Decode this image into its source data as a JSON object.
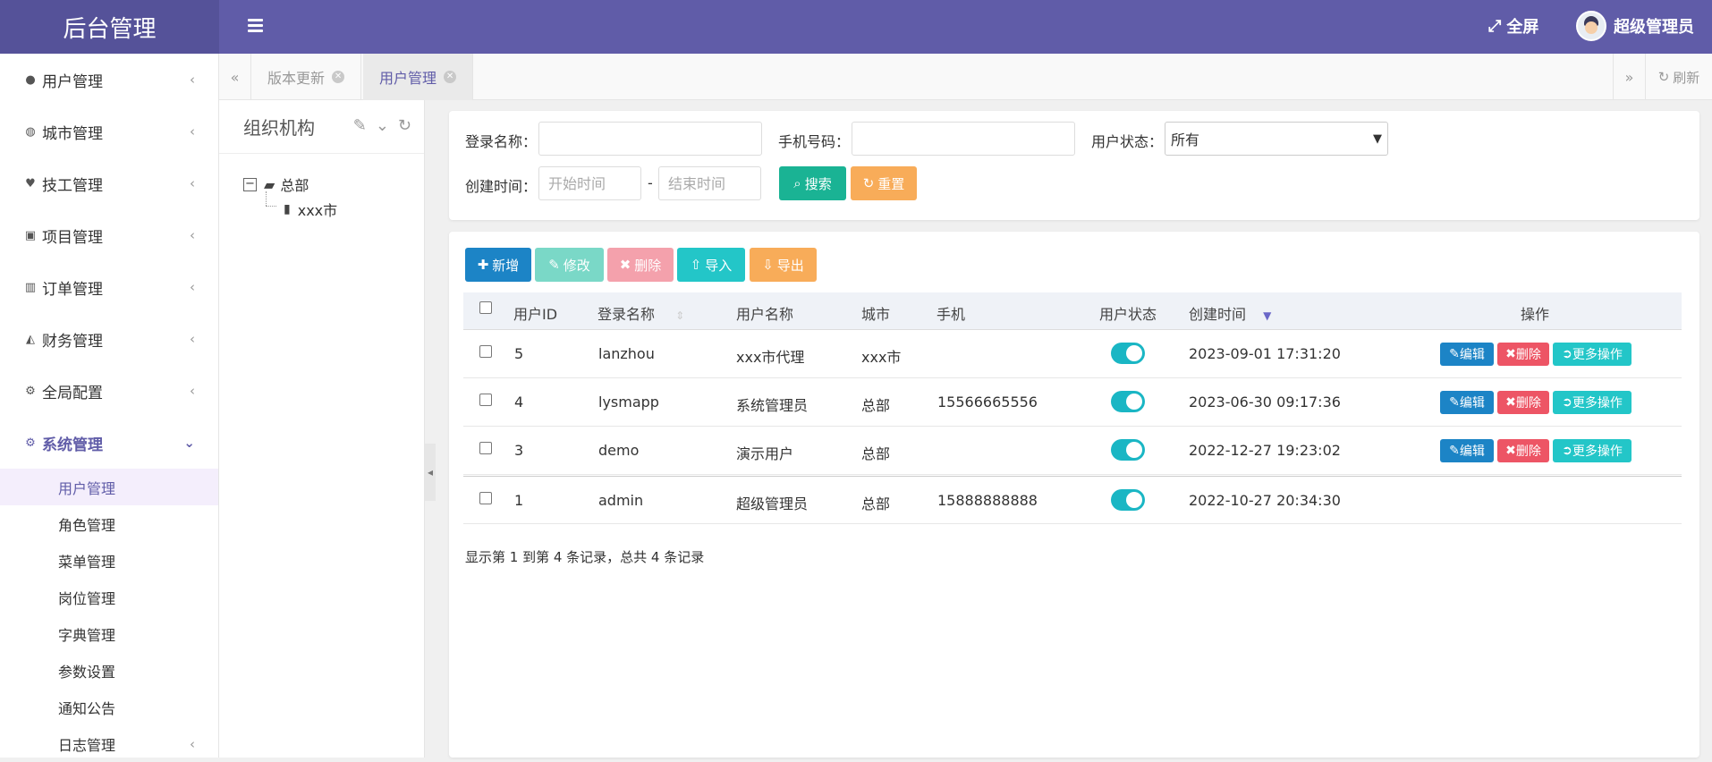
{
  "app": {
    "title": "后台管理"
  },
  "header": {
    "fullscreen_label": "全屏",
    "user_name": "超级管理员"
  },
  "sidebar": {
    "items": [
      {
        "label": "用户管理",
        "icon": "user-icon"
      },
      {
        "label": "城市管理",
        "icon": "globe-icon"
      },
      {
        "label": "技工管理",
        "icon": "heart-icon"
      },
      {
        "label": "项目管理",
        "icon": "ticket-icon"
      },
      {
        "label": "订单管理",
        "icon": "bar-chart-icon"
      },
      {
        "label": "财务管理",
        "icon": "area-chart-icon"
      },
      {
        "label": "全局配置",
        "icon": "cogs-icon"
      },
      {
        "label": "系统管理",
        "icon": "gear-icon"
      }
    ],
    "sub_items": [
      {
        "label": "用户管理"
      },
      {
        "label": "角色管理"
      },
      {
        "label": "菜单管理"
      },
      {
        "label": "岗位管理"
      },
      {
        "label": "字典管理"
      },
      {
        "label": "参数设置"
      },
      {
        "label": "通知公告"
      },
      {
        "label": "日志管理"
      }
    ]
  },
  "tabs": [
    {
      "label": "版本更新"
    },
    {
      "label": "用户管理"
    }
  ],
  "tab_refresh_label": "刷新",
  "tree": {
    "title": "组织机构",
    "root": "总部",
    "child": "xxx市"
  },
  "search": {
    "login_name_label": "登录名称：",
    "phone_label": "手机号码：",
    "status_label": "用户状态：",
    "status_value": "所有",
    "created_label": "创建时间：",
    "start_placeholder": "开始时间",
    "end_placeholder": "结束时间",
    "range_sep": "-",
    "search_btn": "搜索",
    "reset_btn": "重置"
  },
  "toolbar": {
    "add": "新增",
    "edit": "修改",
    "delete": "删除",
    "import": "导入",
    "export": "导出"
  },
  "table": {
    "columns": [
      "用户ID",
      "登录名称",
      "用户名称",
      "城市",
      "手机",
      "用户状态",
      "创建时间",
      "操作"
    ],
    "rows": [
      {
        "id": "5",
        "login": "lanzhou",
        "name": "xxx市代理",
        "city": "xxx市",
        "phone": "",
        "status": true,
        "created": "2023-09-01 17:31:20"
      },
      {
        "id": "4",
        "login": "lysmapp",
        "name": "系统管理员",
        "city": "总部",
        "phone": "15566665556",
        "status": true,
        "created": "2023-06-30 09:17:36"
      },
      {
        "id": "3",
        "login": "demo",
        "name": "演示用户",
        "city": "总部",
        "phone": "",
        "status": true,
        "created": "2022-12-27 19:23:02"
      },
      {
        "id": "1",
        "login": "admin",
        "name": "超级管理员",
        "city": "总部",
        "phone": "15888888888",
        "status": true,
        "created": "2022-10-27 20:34:30"
      }
    ],
    "row_actions": {
      "edit": "编辑",
      "delete": "删除",
      "more": "更多操作"
    },
    "page_info": "显示第 1 到第 4 条记录，总共 4 条记录"
  },
  "colors": {
    "brand": "#605ca8",
    "primary": "#1c84c6",
    "success": "#1ab394",
    "danger": "#ed5565",
    "info": "#23c6c8",
    "warning": "#f8ac59"
  }
}
